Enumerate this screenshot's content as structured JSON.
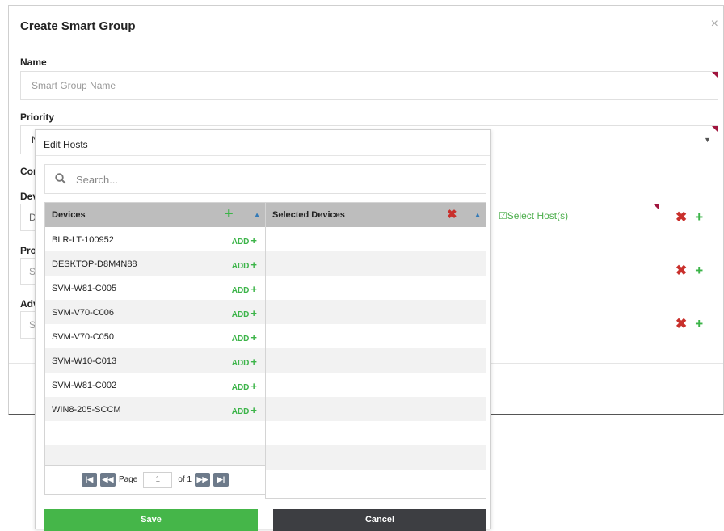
{
  "modal": {
    "title": "Create Smart Group",
    "close": "×",
    "name_label": "Name",
    "name_placeholder": "Smart Group Name",
    "priority_label": "Priority",
    "priority_value_partial": "N",
    "conditions_label_partial": "Con",
    "devices_label_partial": "Dev",
    "devices_value_partial": "De",
    "products_label_partial": "Pro",
    "products_value_partial": "Se",
    "advanced_label_partial": "Adv",
    "advanced_value_partial": "Se",
    "select_hosts_link": "Select Host(s)"
  },
  "popup": {
    "title": "Edit Hosts",
    "search_placeholder": "Search...",
    "left_header": "Devices",
    "right_header": "Selected Devices",
    "add_label": "ADD",
    "devices": [
      "BLR-LT-100952",
      "DESKTOP-D8M4N88",
      "SVM-W81-C005",
      "SVM-V70-C006",
      "SVM-V70-C050",
      "SVM-W10-C013",
      "SVM-W81-C002",
      "WIN8-205-SCCM"
    ],
    "pager": {
      "page_label": "Page",
      "page_value": "1",
      "of_label": "of 1"
    },
    "save_label": "Save",
    "cancel_label": "Cancel"
  },
  "colors": {
    "accent_green": "#45b649",
    "danger_red": "#c9302c",
    "required_flag": "#a0153e",
    "header_gray": "#bdbdbd"
  }
}
